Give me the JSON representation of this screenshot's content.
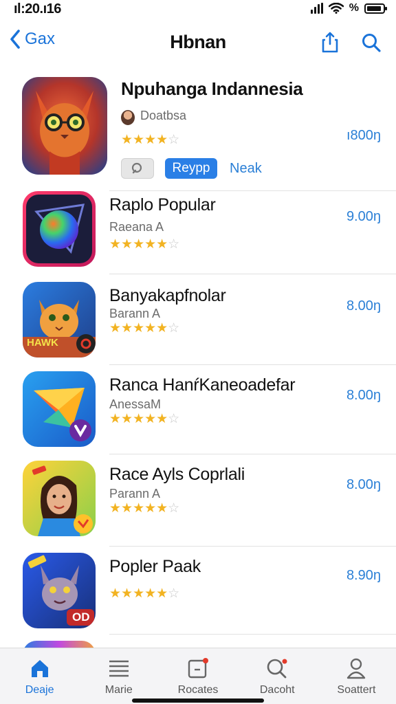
{
  "status": {
    "time": "ıl:20.ı16",
    "battery_pct": "%",
    "battery_level": 0.9
  },
  "nav": {
    "back_label": "Gax",
    "title": "Hbnan",
    "icons": [
      "share-icon",
      "search-icon"
    ]
  },
  "apps": [
    {
      "name": "Npuhanga Indannesia",
      "developer": "Doatbsa",
      "rating": 4.5,
      "price": "ı800ŋ",
      "actions": {
        "chip_gray_icon": "search-icon",
        "chip_blue": "Reypp",
        "link": "Neak"
      }
    },
    {
      "name": "Raplo Popular",
      "developer": "Raeana A",
      "rating": 4.5,
      "price": "9.00ŋ"
    },
    {
      "name": "Banyakapfnolar",
      "developer": "Barann A",
      "rating": 4.5,
      "price": "8.00ŋ",
      "badge": "HAWK"
    },
    {
      "name": "Ranca HanŕKaneoadefar",
      "developer": "AnessaM",
      "rating": 4.5,
      "price": "8.00ŋ"
    },
    {
      "name": "Race Ayls Coprlali",
      "developer": "Parann A",
      "rating": 4.5,
      "price": "8.00ŋ"
    },
    {
      "name": "Popler Paak",
      "developer": "",
      "rating": 4.5,
      "price": "8.90ŋ",
      "badge": "OD"
    }
  ],
  "tabs": [
    {
      "label": "Deaje",
      "icon": "home-icon",
      "active": true
    },
    {
      "label": "Marie",
      "icon": "list-icon",
      "active": false
    },
    {
      "label": "Rocates",
      "icon": "updates-icon",
      "active": false
    },
    {
      "label": "Dacoht",
      "icon": "search-icon",
      "active": false
    },
    {
      "label": "Soattert",
      "icon": "person-icon",
      "active": false
    }
  ],
  "colors": {
    "accent": "#1a73d9",
    "star": "#f2b322",
    "price": "#2a7fd6"
  }
}
